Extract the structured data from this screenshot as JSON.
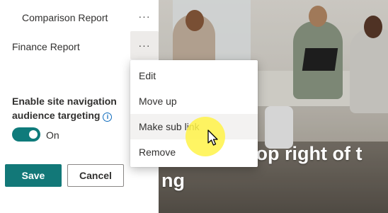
{
  "nav": {
    "items": [
      {
        "label": "Comparison Report",
        "more": "···"
      },
      {
        "label": "Finance Report",
        "more": "···"
      }
    ]
  },
  "settings": {
    "audience_targeting_title": "Enable site navigation audience targeting",
    "info_icon_glyph": "i",
    "toggle_state": "On",
    "toggle_on": true
  },
  "actions": {
    "save_label": "Save",
    "cancel_label": "Cancel"
  },
  "context_menu": {
    "items": [
      {
        "label": "Edit"
      },
      {
        "label": "Move up"
      },
      {
        "label": "Make sub link"
      },
      {
        "label": "Remove"
      }
    ],
    "hovered_item": "Make sub link"
  },
  "hero": {
    "line1": "e top right of t",
    "line2": "ng"
  },
  "colors": {
    "accent": "#127878",
    "toggle": "#0f7b7b",
    "info": "#0f6cbd",
    "cursor_highlight": "#fff348"
  }
}
